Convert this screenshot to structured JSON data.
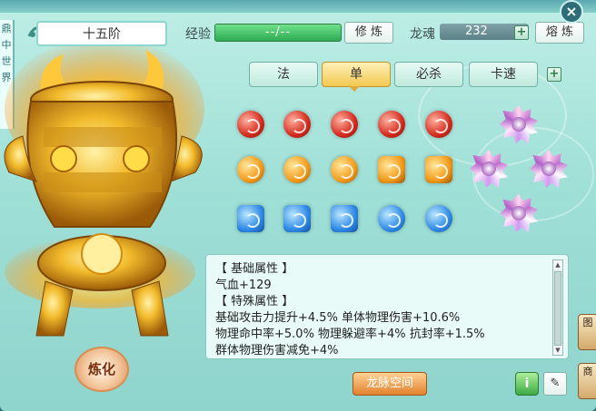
{
  "left_strip_chars": [
    "鼎",
    "中",
    "世",
    "界"
  ],
  "title": "十五阶",
  "experience": {
    "label": "经验",
    "value": "--/--",
    "button": "修 炼"
  },
  "dragon_soul": {
    "label": "龙魂",
    "value": "232",
    "button": "熔 炼"
  },
  "tabs": [
    {
      "label": "法",
      "active": false
    },
    {
      "label": "单",
      "active": true
    },
    {
      "label": "必杀",
      "active": false
    },
    {
      "label": "卡速",
      "active": false
    }
  ],
  "gem_rows": [
    {
      "color": "red",
      "count": 5
    },
    {
      "color": "orange",
      "count": 5
    },
    {
      "color": "blue",
      "count": 5
    }
  ],
  "special_gems": {
    "type": "star-gem-purple",
    "count": 4
  },
  "info": {
    "basic_header": "【 基础属性 】",
    "basic_lines": [
      "气血+129"
    ],
    "special_header": "【 特殊属性 】",
    "special_lines": [
      "基础攻击力提升+4.5%   单体物理伤害+10.6%",
      "物理命中率+5.0%   物理躲避率+4%   抗封率+1.5%",
      "群体物理伤害减免+4%"
    ]
  },
  "buttons": {
    "refine": "炼化",
    "dragon_space": "龙脉空间",
    "info_icon": "i",
    "edit_icon": "edit-icon"
  },
  "side_buttons": [
    "图",
    "商"
  ],
  "colors": {
    "accent_green": "#2faa54",
    "tab_active": "#f3c850",
    "orange_button": "#e2812e"
  }
}
